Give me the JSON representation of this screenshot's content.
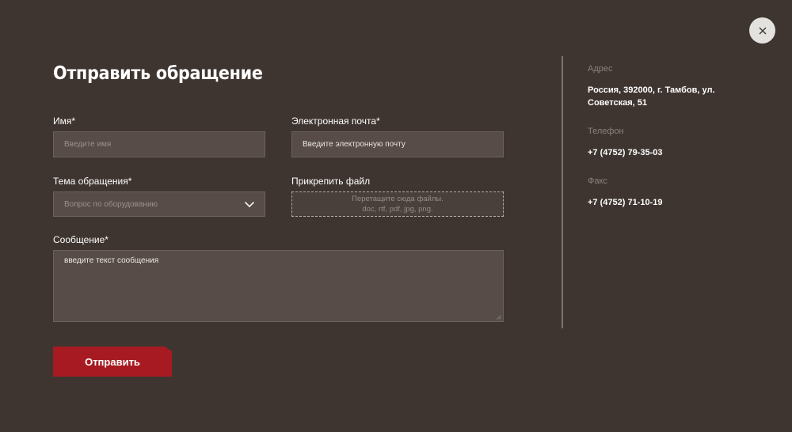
{
  "form": {
    "title": "Отправить обращение",
    "name": {
      "label": "Имя*",
      "placeholder": "Введите имя"
    },
    "email": {
      "label": "Электронная почта*",
      "placeholder": "Введите электронную почту"
    },
    "topic": {
      "label": "Тема обращения*",
      "selected": "Вопрос по оборудованию"
    },
    "attachment": {
      "label": "Прикрепить файл",
      "hint_line1": "Перетащите сюда файлы.",
      "hint_line2": "doc, rtf, pdf, jpg, png."
    },
    "message": {
      "label": "Сообщение*",
      "placeholder": "введите текст сообщения"
    },
    "submit_label": "Отправить"
  },
  "contacts": {
    "address_label": "Адрес",
    "address_line1": "Россия, 392000, г. Тамбов, ул.",
    "address_line2": "Советская, 51",
    "phone_label": "Телефон",
    "phone": "+7 (4752) 79-35-03",
    "fax_label": "Факс",
    "fax": "+7 (4752) 71-10-19"
  },
  "colors": {
    "background": "#3f3530",
    "field": "#574c47",
    "accent": "#a81a21"
  },
  "icons": {
    "close": "close-icon",
    "select": "chevron-down-icon"
  }
}
